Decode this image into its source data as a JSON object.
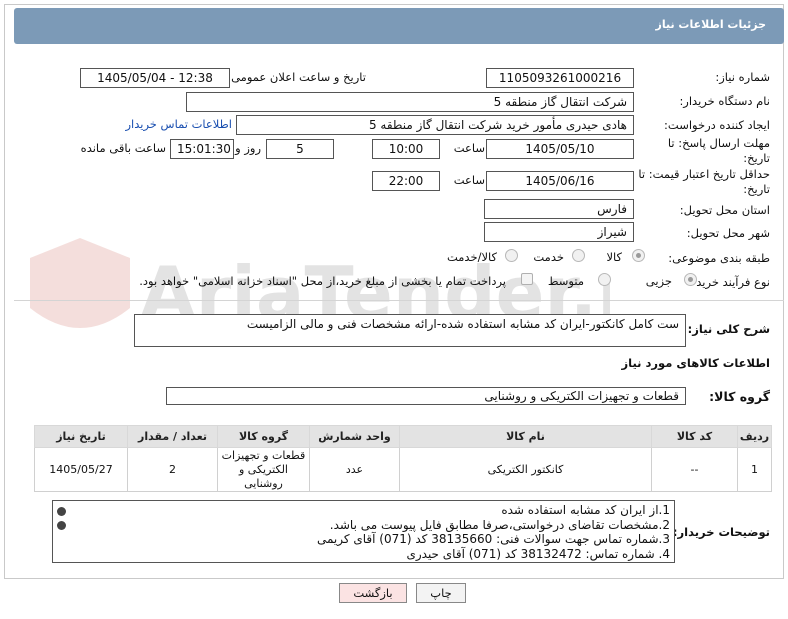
{
  "header": {
    "title": "جزئیات اطلاعات نیاز"
  },
  "fields": {
    "need_number_label": "شماره نیاز:",
    "need_number": "1105093261000216",
    "announce_label": "تاریخ و ساعت اعلان عمومی:",
    "announce_value": "1405/05/04 - 12:38",
    "buyer_org_label": "نام دستگاه خریدار:",
    "buyer_org": "شرکت انتقال گاز منطقه 5",
    "creator_label": "ایجاد کننده درخواست:",
    "creator": "هادی حیدری مأمور خرید شرکت انتقال گاز منطقه 5",
    "contact_link": "اطلاعات تماس خریدار",
    "reply_deadline_label": "مهلت ارسال پاسخ: تا تاریخ:",
    "reply_date": "1405/05/10",
    "time_label": "ساعت",
    "reply_time": "10:00",
    "days_value": "5",
    "days_label": "روز و",
    "remaining_time": "15:01:30",
    "remaining_label": "ساعت باقی مانده",
    "price_validity_label": "حداقل تاریخ اعتبار قیمت: تا تاریخ:",
    "validity_date": "1405/06/16",
    "validity_time": "22:00",
    "province_label": "استان محل تحویل:",
    "province": "فارس",
    "city_label": "شهر محل تحویل:",
    "city": "شیراز",
    "category_label": "طبقه بندی موضوعی:",
    "cat_options": [
      "کالا",
      "خدمت",
      "کالا/خدمت"
    ],
    "process_label": "نوع فرآیند خرید :",
    "process_options": [
      "جزیی",
      "متوسط"
    ],
    "payment_note": "پرداخت تمام یا بخشی از مبلغ خرید،از محل \"اسناد خزانه اسلامی\" خواهد بود."
  },
  "summary": {
    "label": "شرح کلی نیاز:",
    "text": "ست کامل کانکتور-ایران کد مشابه استفاده شده-ارائه مشخصات فنی و مالی الزامیست"
  },
  "goods": {
    "section_title": "اطلاعات کالاهای مورد نیاز",
    "group_label": "گروه کالا:",
    "group_value": "قطعات و تجهیزات الکتریکی و روشنایی",
    "columns": [
      "ردیف",
      "کد کالا",
      "نام کالا",
      "واحد شمارش",
      "گروه کالا",
      "تعداد / مقدار",
      "تاریخ نیاز"
    ],
    "rows": [
      [
        "1",
        "--",
        "کانکتور الکتریکی",
        "عدد",
        "قطعات و تجهیزات الکتریکی و روشنایی",
        "2",
        "1405/05/27"
      ]
    ]
  },
  "buyer_notes": {
    "label": "توضیحات خریدار:",
    "lines": [
      "1.از ایران کد مشابه استفاده شده",
      "2.مشخصات تقاضای درخواستی،صرفا مطابق فایل پیوست می باشد.",
      "3.شماره تماس جهت سوالات فنی: 38135660 کد (071) آقای کریمی",
      "4. شماره تماس:  38132472 کد (071) آقای حیدری"
    ]
  },
  "buttons": {
    "print": "چاپ",
    "back": "بازگشت"
  },
  "watermark": {
    "brand": "AriaTender.net"
  },
  "colors": {
    "titlebar": "#7c9ab7",
    "link": "#1a4fb0",
    "back_bg": "#fbe3e3"
  }
}
